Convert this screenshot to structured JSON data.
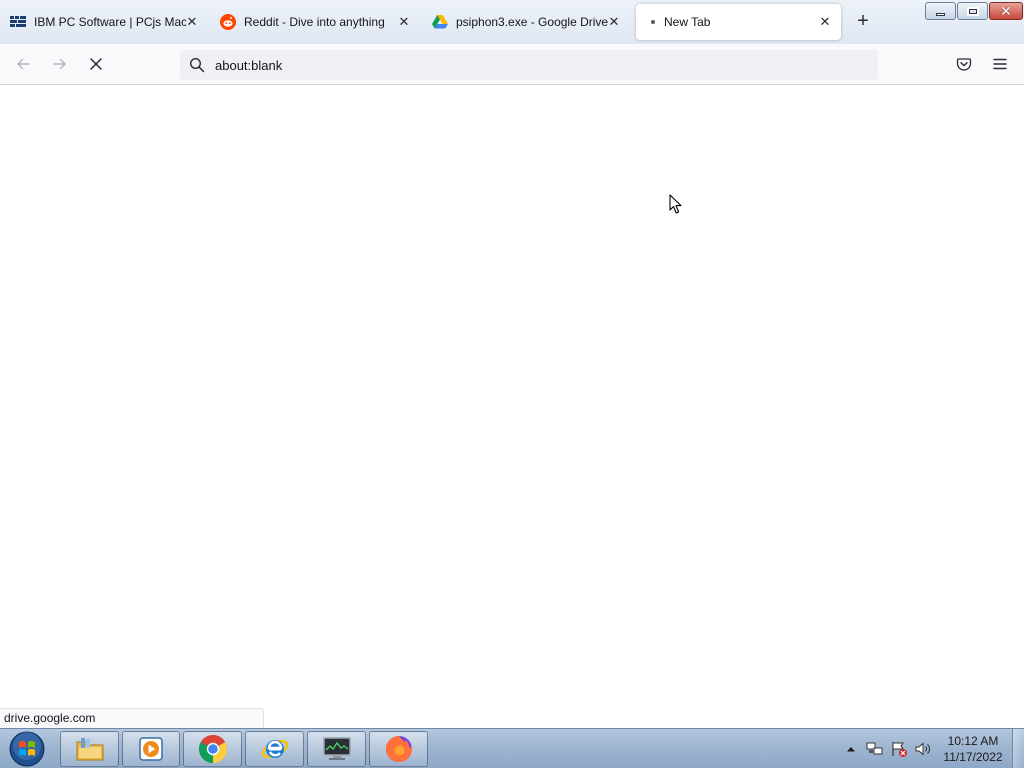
{
  "browser": {
    "tabs": [
      {
        "title": "IBM PC Software | PCjs Machines",
        "favicon": "pcjs-icon",
        "active": false
      },
      {
        "title": "Reddit - Dive into anything",
        "favicon": "reddit-icon",
        "active": false
      },
      {
        "title": "psiphon3.exe - Google Drive",
        "favicon": "google-drive-icon",
        "active": false
      },
      {
        "title": "New Tab",
        "favicon": "loading-dot-icon",
        "active": true
      }
    ],
    "new_tab_label": "+",
    "url": "about:blank",
    "status_text": "drive.google.com",
    "nav_icons": [
      "back-arrow-icon",
      "forward-arrow-icon",
      "stop-icon",
      "search-icon",
      "pocket-icon",
      "hamburger-menu-icon"
    ],
    "accent_color": "#0060df"
  },
  "window": {
    "caption_buttons": [
      "minimize",
      "maximize",
      "close"
    ]
  },
  "taskbar": {
    "pinned": [
      "windows-start-icon",
      "file-explorer-icon",
      "media-player-icon",
      "chrome-icon",
      "internet-explorer-icon",
      "system-monitor-icon",
      "firefox-icon"
    ],
    "tray_icons": [
      "show-hidden-icons-icon",
      "network-icon",
      "action-center-icon",
      "volume-icon"
    ],
    "clock_time": "10:12 AM",
    "clock_date": "11/17/2022"
  }
}
